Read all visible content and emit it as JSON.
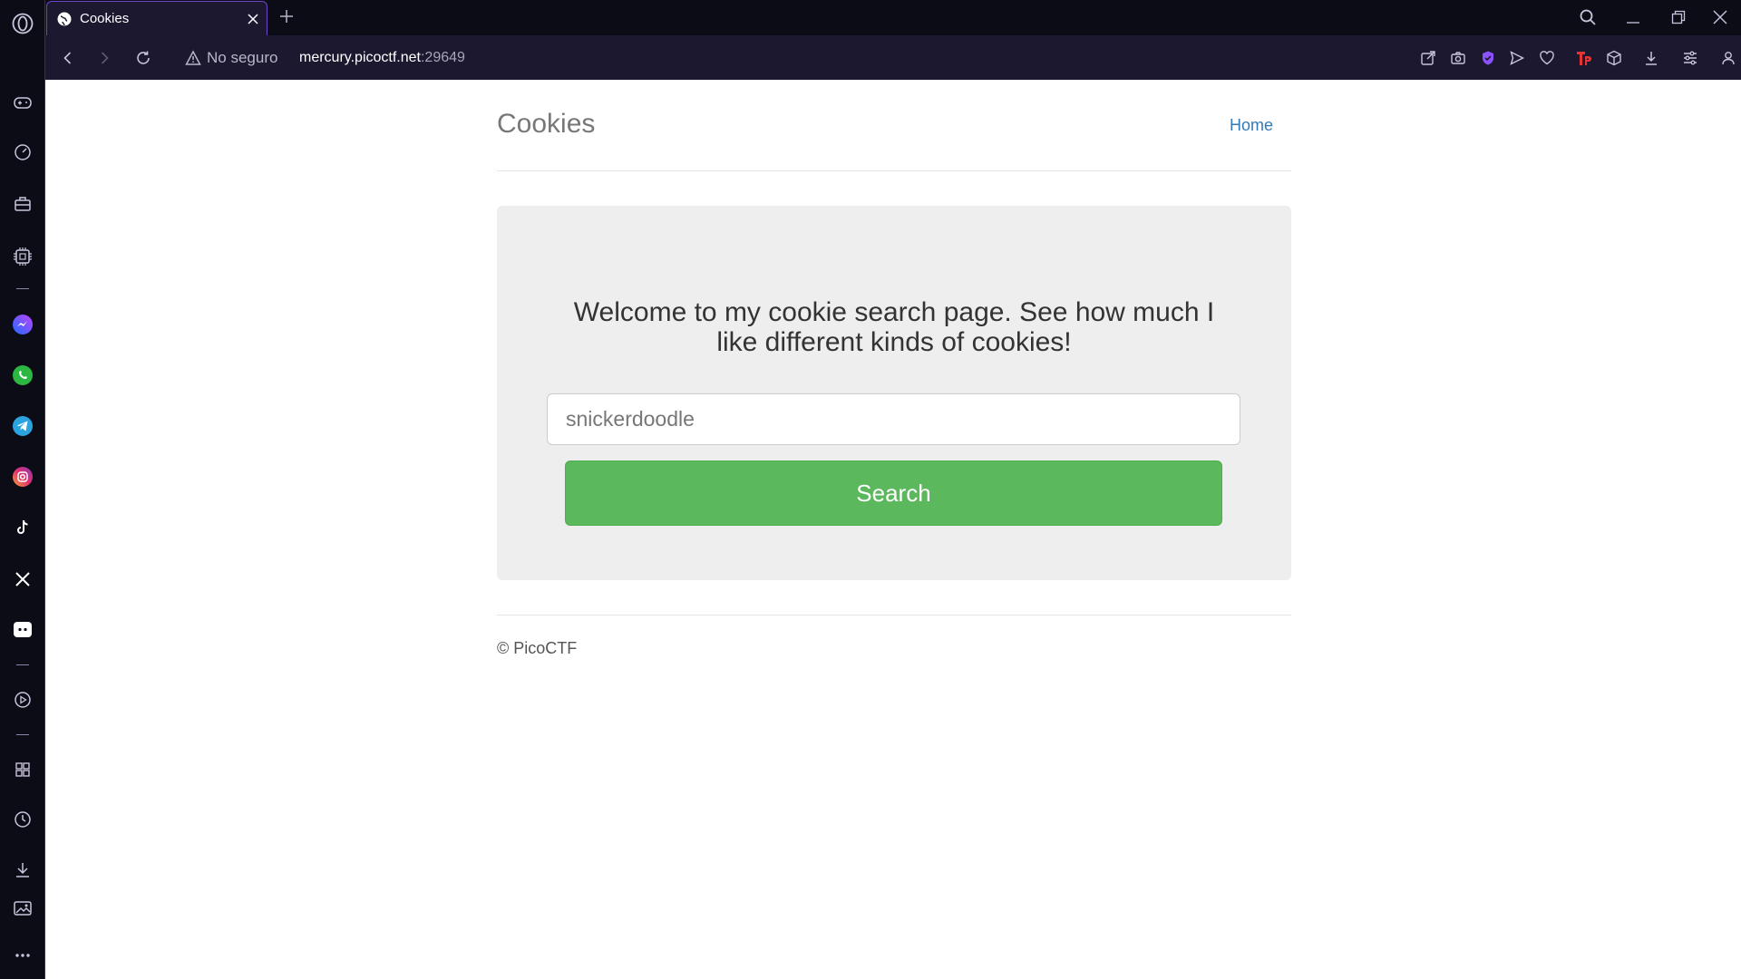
{
  "browser": {
    "tab": {
      "title": "Cookies",
      "favicon": "globe-icon"
    },
    "security_label": "No seguro",
    "url_domain": "mercury.picoctf.net",
    "url_port": ":29649",
    "accent": "#6d45c9"
  },
  "sidebar": {
    "icons": [
      "opera-logo-icon",
      "gamepad-icon",
      "speed-dial-icon",
      "briefcase-icon",
      "cpu-icon",
      "messenger-icon",
      "whatsapp-icon",
      "telegram-icon",
      "instagram-icon",
      "tiktok-icon",
      "x-icon",
      "discord-icon",
      "player-icon",
      "apps-icon",
      "history-icon",
      "downloads-icon",
      "image-icon",
      "more-icon"
    ]
  },
  "page": {
    "site_title": "Cookies",
    "nav": {
      "home": "Home"
    },
    "welcome": "Welcome to my cookie search page. See how much I like different kinds of cookies!",
    "search": {
      "placeholder": "snickerdoodle",
      "value": "",
      "button": "Search"
    },
    "footer": "© PicoCTF",
    "colors": {
      "button": "#5cb85c",
      "link": "#337ab7",
      "jumbotron": "#eeeeee"
    }
  }
}
